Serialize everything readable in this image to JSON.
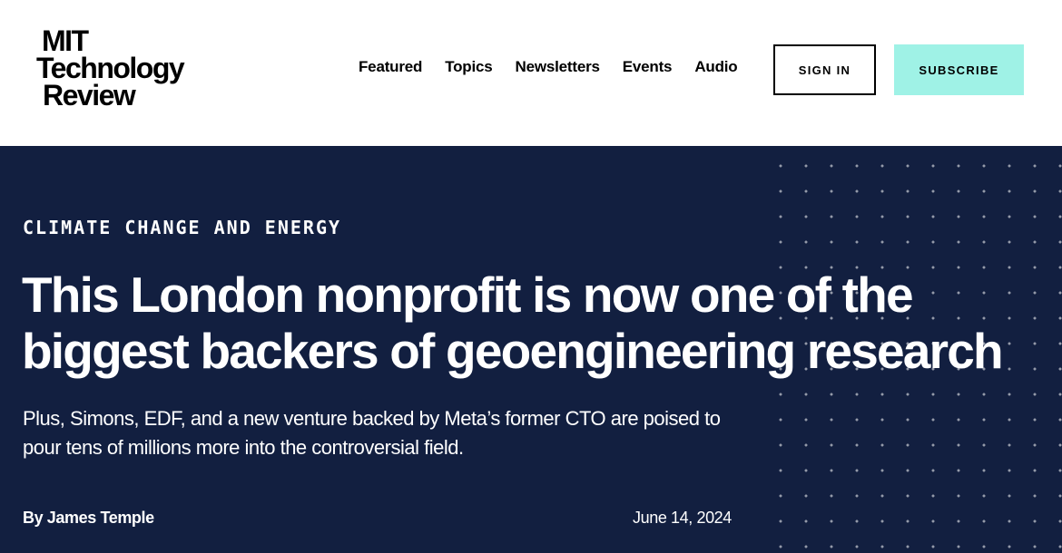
{
  "header": {
    "logo": {
      "line1": "MIT",
      "line2": "Technology",
      "line3": "Review"
    },
    "nav": [
      {
        "label": "Featured"
      },
      {
        "label": "Topics"
      },
      {
        "label": "Newsletters"
      },
      {
        "label": "Events"
      },
      {
        "label": "Audio"
      }
    ],
    "sign_in_label": "SIGN IN",
    "subscribe_label": "SUBSCRIBE"
  },
  "article": {
    "kicker": "CLIMATE CHANGE AND ENERGY",
    "headline": "This London nonprofit is now one of the biggest backers of geoengineering research",
    "dek": "Plus, Simons, EDF, and a new venture backed by Meta’s former CTO are poised to pour tens of millions more into the controversial field.",
    "byline": "By James Temple",
    "date": "June 14, 2024"
  },
  "colors": {
    "hero_background": "#121f40",
    "subscribe_background": "#9ff2e6",
    "text_on_hero": "#ffffff"
  }
}
